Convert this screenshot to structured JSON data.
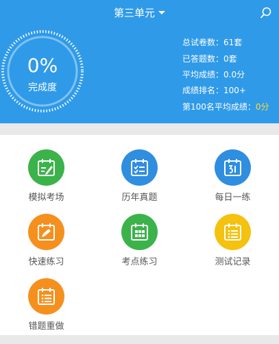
{
  "header": {
    "title": "第三单元",
    "search_icon": "search-icon",
    "dropdown_icon": "caret-down-icon"
  },
  "progress": {
    "percent_text": "0%",
    "label": "完成度",
    "value": 0
  },
  "stats": {
    "total_papers": "总试卷数：61套",
    "answered": "已答题数：0套",
    "average_score": "平均成绩：0.0分",
    "rank": "成绩排名：100+",
    "top100_label": "第100名平均成绩：",
    "top100_value": "0分"
  },
  "colors": {
    "header": "#2f9ae8",
    "green": "#3bb34a",
    "blue": "#2f8ee0",
    "orange": "#f5901e",
    "yellow": "#f4c20f",
    "highlight": "#ffde33"
  },
  "menu": [
    {
      "label": "模拟考场",
      "icon": "calendar-edit-icon",
      "color": "#3bb34a"
    },
    {
      "label": "历年真题",
      "icon": "calendar-checklist-icon",
      "color": "#2f8ee0"
    },
    {
      "label": "每日一练",
      "icon": "calendar-day-icon",
      "color": "#2f8ee0"
    },
    {
      "label": "快速练习",
      "icon": "calendar-pencil-icon",
      "color": "#f5901e"
    },
    {
      "label": "考点练习",
      "icon": "calendar-grid-icon",
      "color": "#3bb34a"
    },
    {
      "label": "测试记录",
      "icon": "calendar-list-icon",
      "color": "#f4c20f"
    },
    {
      "label": "错题重做",
      "icon": "calendar-list-icon",
      "color": "#f5901e"
    }
  ]
}
